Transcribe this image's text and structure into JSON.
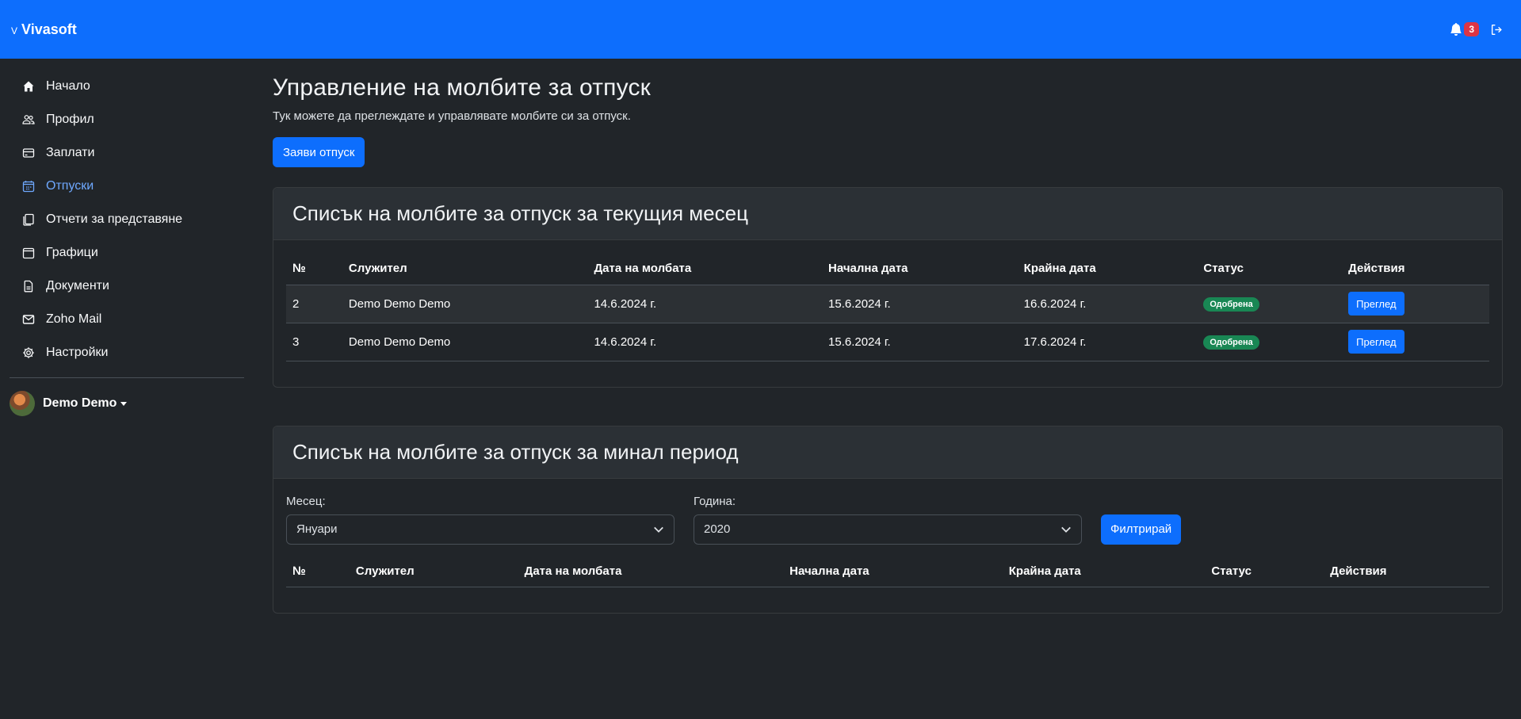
{
  "brand": {
    "mark": "V",
    "name": "Vivasoft"
  },
  "header": {
    "notification_count": "3"
  },
  "sidebar": {
    "items": [
      {
        "label": "Начало",
        "icon": "home-icon"
      },
      {
        "label": "Профил",
        "icon": "people-icon"
      },
      {
        "label": "Заплати",
        "icon": "credit-card-icon"
      },
      {
        "label": "Отпуски",
        "icon": "calendar-icon",
        "active": true
      },
      {
        "label": "Отчети за представяне",
        "icon": "copy-icon"
      },
      {
        "label": "Графици",
        "icon": "calendar-blank-icon"
      },
      {
        "label": "Документи",
        "icon": "file-icon"
      },
      {
        "label": "Zoho Mail",
        "icon": "envelope-icon"
      },
      {
        "label": "Настройки",
        "icon": "gear-icon"
      }
    ],
    "user": {
      "name": "Demo Demo"
    }
  },
  "main": {
    "title": "Управление на молбите за отпуск",
    "subtitle": "Тук можете да преглеждате и управлявате молбите си за отпуск.",
    "request_button": "Заяви отпуск"
  },
  "current_card": {
    "title": "Списък на молбите за отпуск за текущия месец",
    "columns": [
      "№",
      "Служител",
      "Дата на молбата",
      "Начална дата",
      "Крайна дата",
      "Статус",
      "Действия"
    ],
    "rows": [
      {
        "no": "2",
        "employee": "Demo Demo Demo",
        "request_date": "14.6.2024 г.",
        "start_date": "15.6.2024 г.",
        "end_date": "16.6.2024 г.",
        "status": "Одобрена",
        "action": "Преглед"
      },
      {
        "no": "3",
        "employee": "Demo Demo Demo",
        "request_date": "14.6.2024 г.",
        "start_date": "15.6.2024 г.",
        "end_date": "17.6.2024 г.",
        "status": "Одобрена",
        "action": "Преглед"
      }
    ]
  },
  "past_card": {
    "title": "Списък на молбите за отпуск за минал период",
    "month_label": "Месец:",
    "month_value": "Януари",
    "year_label": "Година:",
    "year_value": "2020",
    "filter_button": "Филтрирай",
    "columns": [
      "№",
      "Служител",
      "Дата на молбата",
      "Начална дата",
      "Крайна дата",
      "Статус",
      "Действия"
    ]
  },
  "colors": {
    "primary": "#0d6efd",
    "success": "#198754",
    "danger": "#dc3545",
    "background": "#212529"
  }
}
